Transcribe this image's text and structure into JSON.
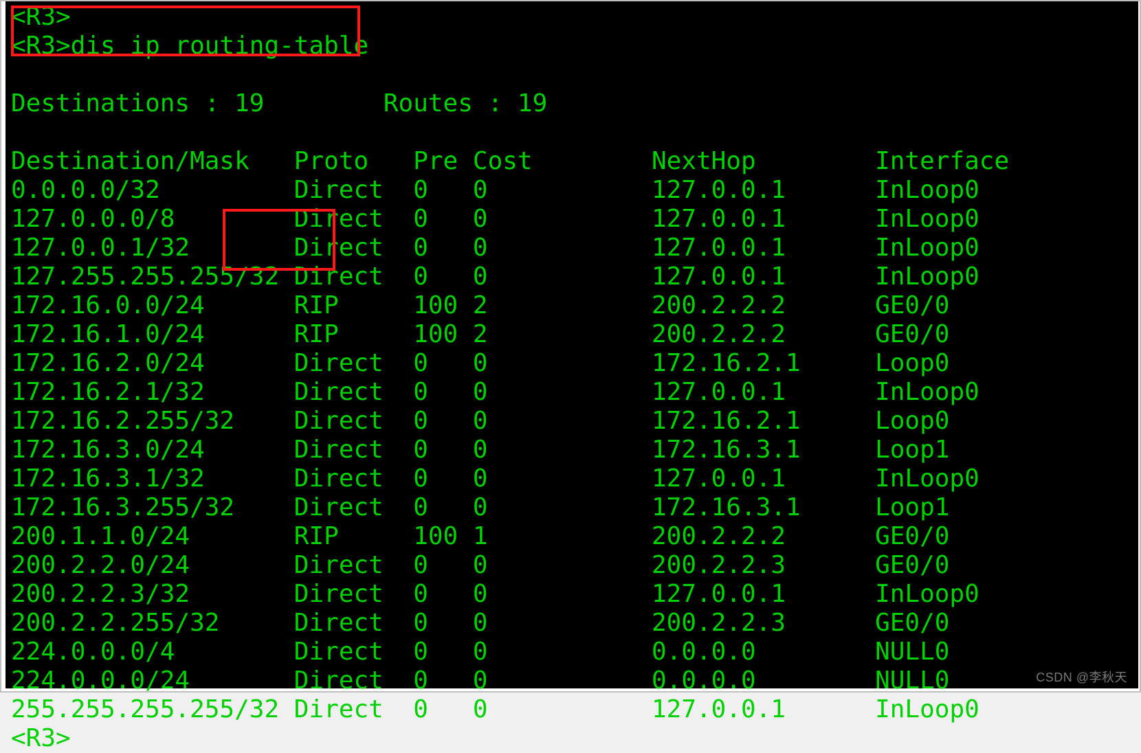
{
  "prompts": {
    "line1": "<R3>",
    "line2_prompt": "<R3>",
    "line2_cmd": "dis ip routing-table",
    "final": "<R3>"
  },
  "summary": {
    "dest_label": "Destinations : ",
    "dest_value": "19",
    "routes_label": "Routes : ",
    "routes_value": "19"
  },
  "headers": {
    "dest": "Destination/Mask",
    "proto": "Proto",
    "pre": "Pre",
    "cost": "Cost",
    "nexthop": "NextHop",
    "iface": "Interface"
  },
  "rows": [
    {
      "dest": "0.0.0.0/32",
      "proto": "Direct",
      "pre": "0",
      "cost": "0",
      "nexthop": "127.0.0.1",
      "iface": "InLoop0"
    },
    {
      "dest": "127.0.0.0/8",
      "proto": "Direct",
      "pre": "0",
      "cost": "0",
      "nexthop": "127.0.0.1",
      "iface": "InLoop0"
    },
    {
      "dest": "127.0.0.1/32",
      "proto": "Direct",
      "pre": "0",
      "cost": "0",
      "nexthop": "127.0.0.1",
      "iface": "InLoop0"
    },
    {
      "dest": "127.255.255.255/32",
      "proto": "Direct",
      "pre": "0",
      "cost": "0",
      "nexthop": "127.0.0.1",
      "iface": "InLoop0"
    },
    {
      "dest": "172.16.0.0/24",
      "proto": "RIP",
      "pre": "100",
      "cost": "2",
      "nexthop": "200.2.2.2",
      "iface": "GE0/0"
    },
    {
      "dest": "172.16.1.0/24",
      "proto": "RIP",
      "pre": "100",
      "cost": "2",
      "nexthop": "200.2.2.2",
      "iface": "GE0/0"
    },
    {
      "dest": "172.16.2.0/24",
      "proto": "Direct",
      "pre": "0",
      "cost": "0",
      "nexthop": "172.16.2.1",
      "iface": "Loop0"
    },
    {
      "dest": "172.16.2.1/32",
      "proto": "Direct",
      "pre": "0",
      "cost": "0",
      "nexthop": "127.0.0.1",
      "iface": "InLoop0"
    },
    {
      "dest": "172.16.2.255/32",
      "proto": "Direct",
      "pre": "0",
      "cost": "0",
      "nexthop": "172.16.2.1",
      "iface": "Loop0"
    },
    {
      "dest": "172.16.3.0/24",
      "proto": "Direct",
      "pre": "0",
      "cost": "0",
      "nexthop": "172.16.3.1",
      "iface": "Loop1"
    },
    {
      "dest": "172.16.3.1/32",
      "proto": "Direct",
      "pre": "0",
      "cost": "0",
      "nexthop": "127.0.0.1",
      "iface": "InLoop0"
    },
    {
      "dest": "172.16.3.255/32",
      "proto": "Direct",
      "pre": "0",
      "cost": "0",
      "nexthop": "172.16.3.1",
      "iface": "Loop1"
    },
    {
      "dest": "200.1.1.0/24",
      "proto": "RIP",
      "pre": "100",
      "cost": "1",
      "nexthop": "200.2.2.2",
      "iface": "GE0/0"
    },
    {
      "dest": "200.2.2.0/24",
      "proto": "Direct",
      "pre": "0",
      "cost": "0",
      "nexthop": "200.2.2.3",
      "iface": "GE0/0"
    },
    {
      "dest": "200.2.2.3/32",
      "proto": "Direct",
      "pre": "0",
      "cost": "0",
      "nexthop": "127.0.0.1",
      "iface": "InLoop0"
    },
    {
      "dest": "200.2.2.255/32",
      "proto": "Direct",
      "pre": "0",
      "cost": "0",
      "nexthop": "200.2.2.3",
      "iface": "GE0/0"
    },
    {
      "dest": "224.0.0.0/4",
      "proto": "Direct",
      "pre": "0",
      "cost": "0",
      "nexthop": "0.0.0.0",
      "iface": "NULL0"
    },
    {
      "dest": "224.0.0.0/24",
      "proto": "Direct",
      "pre": "0",
      "cost": "0",
      "nexthop": "0.0.0.0",
      "iface": "NULL0"
    },
    {
      "dest": "255.255.255.255/32",
      "proto": "Direct",
      "pre": "0",
      "cost": "0",
      "nexthop": "127.0.0.1",
      "iface": "InLoop0"
    }
  ],
  "watermark": "CSDN @李秋天"
}
